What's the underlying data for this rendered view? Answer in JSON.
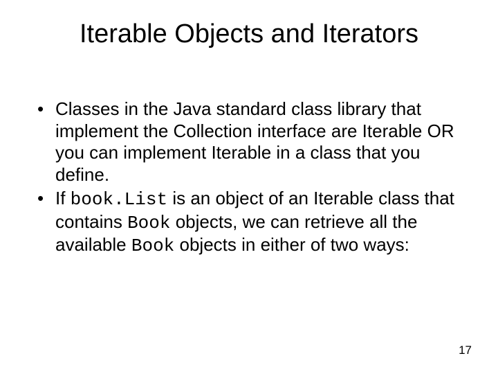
{
  "title": "Iterable Objects and Iterators",
  "bullet1": {
    "text": "Classes in the Java standard class library that implement the Collection interface are Iterable OR you can implement Iterable in a class that you define."
  },
  "bullet2": {
    "p1": "If ",
    "code1": "book.List",
    "p2": " is an object of an Iterable class that contains ",
    "code2": "Book",
    "p3": " objects, we can retrieve all the available ",
    "code3": "Book",
    "p4": " objects in either of two ways:"
  },
  "page_number": "17"
}
